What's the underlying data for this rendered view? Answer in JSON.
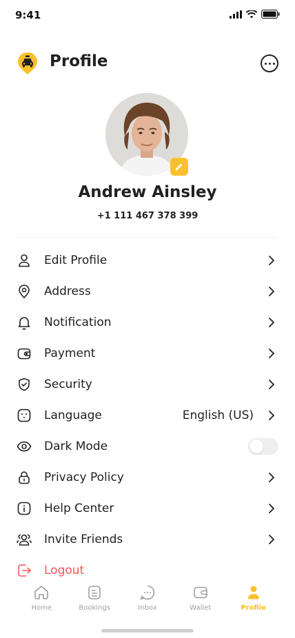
{
  "status_bar": {
    "time": "9:41"
  },
  "header": {
    "title": "Profile"
  },
  "profile": {
    "name": "Andrew Ainsley",
    "phone": "+1 111 467 378 399"
  },
  "menu": [
    {
      "label": "Edit Profile",
      "icon": "user-icon"
    },
    {
      "label": "Address",
      "icon": "location-icon"
    },
    {
      "label": "Notification",
      "icon": "bell-icon"
    },
    {
      "label": "Payment",
      "icon": "wallet-icon"
    },
    {
      "label": "Security",
      "icon": "shield-icon"
    },
    {
      "label": "Language",
      "icon": "language-icon",
      "value": "English (US)"
    },
    {
      "label": "Dark Mode",
      "icon": "eye-icon",
      "toggle": false
    },
    {
      "label": "Privacy Policy",
      "icon": "lock-icon"
    },
    {
      "label": "Help Center",
      "icon": "info-icon"
    },
    {
      "label": "Invite Friends",
      "icon": "users-icon"
    },
    {
      "label": "Logout",
      "icon": "logout-icon"
    }
  ],
  "bottom_nav": [
    {
      "label": "Home",
      "icon": "home-icon"
    },
    {
      "label": "Bookings",
      "icon": "document-icon"
    },
    {
      "label": "Inbox",
      "icon": "chat-icon"
    },
    {
      "label": "Wallet",
      "icon": "wallet-icon"
    },
    {
      "label": "Profile",
      "icon": "profile-icon",
      "active": true
    }
  ],
  "colors": {
    "accent": "#FBC02D",
    "danger": "#F75555",
    "text": "#212121",
    "muted": "#9E9E9E"
  }
}
